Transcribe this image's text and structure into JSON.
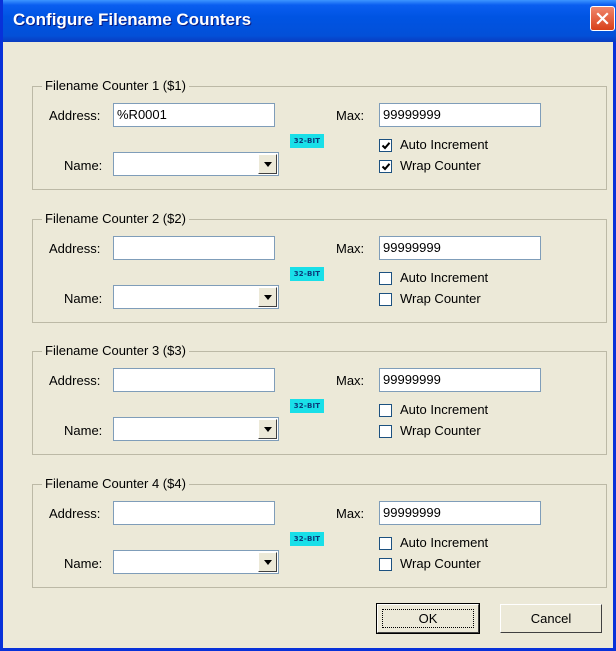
{
  "window": {
    "title": "Configure Filename Counters"
  },
  "labels": {
    "address": "Address:",
    "name": "Name:",
    "max": "Max:",
    "auto_increment": "Auto Increment",
    "wrap_counter": "Wrap Counter",
    "bit_badge": "32-BIT"
  },
  "counters": [
    {
      "title": "Filename Counter 1 ($1)",
      "address": "%R0001",
      "name": "",
      "max": "99999999",
      "auto_increment": true,
      "wrap_counter": true
    },
    {
      "title": "Filename Counter 2 ($2)",
      "address": "",
      "name": "",
      "max": "99999999",
      "auto_increment": false,
      "wrap_counter": false
    },
    {
      "title": "Filename Counter 3 ($3)",
      "address": "",
      "name": "",
      "max": "99999999",
      "auto_increment": false,
      "wrap_counter": false
    },
    {
      "title": "Filename Counter 4 ($4)",
      "address": "",
      "name": "",
      "max": "99999999",
      "auto_increment": false,
      "wrap_counter": false
    }
  ],
  "buttons": {
    "ok": "OK",
    "cancel": "Cancel"
  },
  "colors": {
    "titlebar": "#0054e3",
    "badge": "#19dfe8",
    "dialog_bg": "#ece9d8"
  }
}
